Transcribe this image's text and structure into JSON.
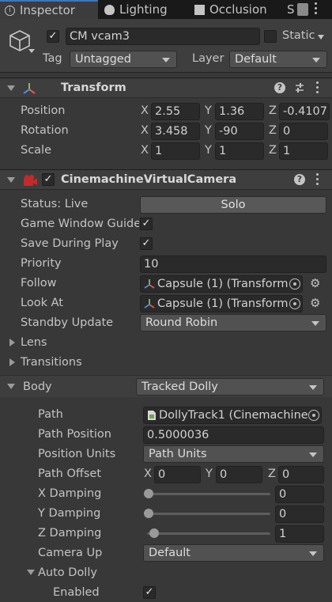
{
  "tabs": {
    "inspector": "Inspector",
    "lighting": "Lighting",
    "occlusion": "Occlusion",
    "overflow": "S"
  },
  "header": {
    "object_name": "CM vcam3",
    "static_label": "Static",
    "tag_label": "Tag",
    "tag_value": "Untagged",
    "layer_label": "Layer",
    "layer_value": "Default"
  },
  "transform": {
    "title": "Transform",
    "position_label": "Position",
    "rotation_label": "Rotation",
    "scale_label": "Scale",
    "x": "X",
    "y": "Y",
    "z": "Z",
    "position": {
      "x": "2.55",
      "y": "1.36",
      "z": "-0.4107"
    },
    "rotation": {
      "x": "3.458",
      "y": "-90",
      "z": "0"
    },
    "scale": {
      "x": "1",
      "y": "1",
      "z": "1"
    }
  },
  "vcam": {
    "title": "CinemachineVirtualCamera",
    "status_label": "Status: Live",
    "solo_label": "Solo",
    "game_window_guides_label": "Game Window Guide",
    "save_during_play_label": "Save During Play",
    "priority_label": "Priority",
    "priority_value": "10",
    "follow_label": "Follow",
    "follow_value": "Capsule (1) (Transform",
    "look_at_label": "Look At",
    "look_at_value": "Capsule (1) (Transform",
    "standby_update_label": "Standby Update",
    "standby_update_value": "Round Robin",
    "lens_label": "Lens",
    "transitions_label": "Transitions",
    "body_label": "Body",
    "body_value": "Tracked Dolly"
  },
  "body": {
    "path_label": "Path",
    "path_value": "DollyTrack1 (Cinemachine",
    "path_position_label": "Path Position",
    "path_position_value": "0.5000036",
    "position_units_label": "Position Units",
    "position_units_value": "Path Units",
    "path_offset_label": "Path Offset",
    "path_offset": {
      "x": "0",
      "y": "0",
      "z": "0"
    },
    "x_damping_label": "X Damping",
    "x_damping_value": "0",
    "y_damping_label": "Y Damping",
    "y_damping_value": "0",
    "z_damping_label": "Z Damping",
    "z_damping_value": "1",
    "camera_up_label": "Camera Up",
    "camera_up_value": "Default",
    "auto_dolly_label": "Auto Dolly",
    "enabled_label": "Enabled"
  },
  "sliders": {
    "x_damping_fraction": 0.0,
    "y_damping_fraction": 0.0,
    "z_damping_fraction": 0.05
  }
}
